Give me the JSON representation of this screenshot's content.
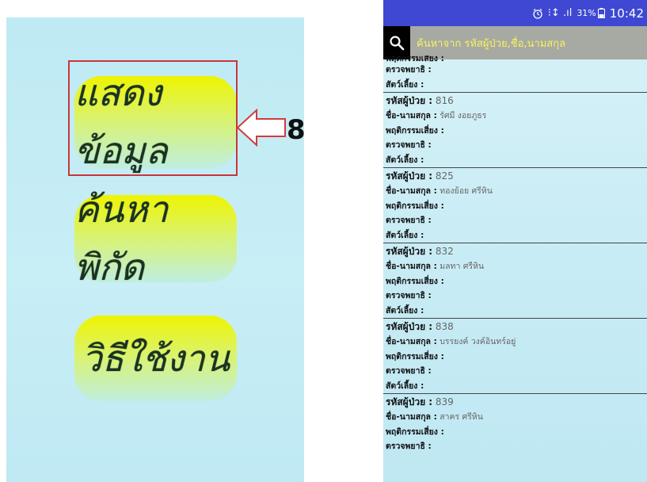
{
  "left": {
    "buttons": [
      {
        "label": "แสดงข้อมูล"
      },
      {
        "label": "ค้นหาพิกัด"
      },
      {
        "label": "วิธีใช้งาน"
      }
    ],
    "annotation": {
      "step": "8"
    }
  },
  "phone": {
    "status": {
      "signal": "⁝↕ .ıl",
      "battery": "31%",
      "time": "10:42"
    },
    "search": {
      "placeholder": "ค้นหาจาก รหัสผู้ป่วย,ชื่อ,นามสกุล"
    },
    "labels": {
      "code": "รหัสผู้ป่วย :",
      "name": "ชื่อ-นามสกุล :",
      "behavior": "พฤติกรรมเสี่ยง :",
      "check": "ตรวจพยาธิ :",
      "animal": "สัตว์เลี้ยง :"
    },
    "records": [
      {
        "code": "816",
        "name": "รัศมี งอยภูธร"
      },
      {
        "code": "825",
        "name": "ทองย้อย ศรีหิน"
      },
      {
        "code": "832",
        "name": "มลทา ศรีหิน"
      },
      {
        "code": "838",
        "name": "บรรยงค์ วงค์อินทร์อยู่"
      },
      {
        "code": "839",
        "name": "สาคร ศรีหิน"
      }
    ]
  },
  "colors": {
    "statusbar": "#3e48d2",
    "searchbar": "#a7aaa3",
    "placeholder": "#f9f25a",
    "highlight": "#c9363b",
    "button_top": "#eef400",
    "button_bottom": "#bfeee0"
  },
  "icons": [
    "alarm-icon",
    "signal-icon",
    "battery-icon",
    "search-icon",
    "arrow-left-icon"
  ]
}
